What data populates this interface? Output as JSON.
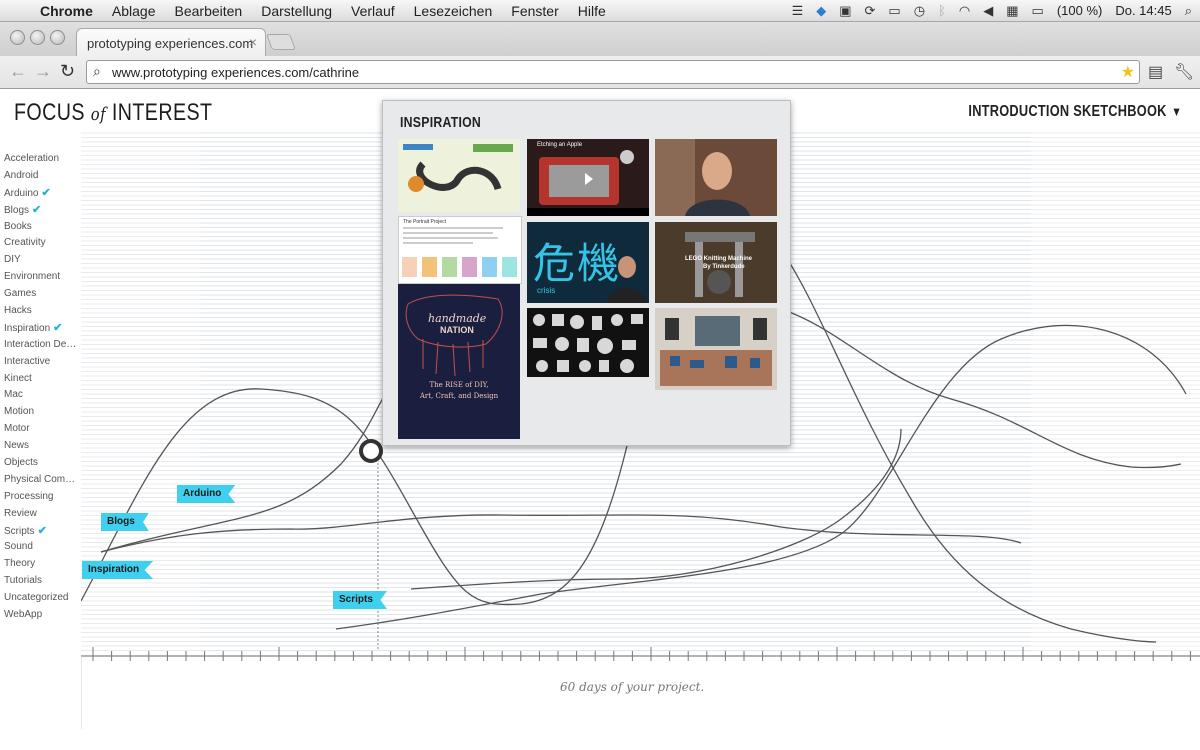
{
  "menubar": {
    "apple": "",
    "items": [
      "Chrome",
      "Ablage",
      "Bearbeiten",
      "Darstellung",
      "Verlauf",
      "Lesezeichen",
      "Fenster",
      "Hilfe"
    ],
    "battery": "(100 %)",
    "clock": "Do. 14:45"
  },
  "browser": {
    "tab_title": "prototyping experiences.com",
    "tab_close": "×",
    "url": "www.prototyping experiences.com/cathrine"
  },
  "page": {
    "logo_left": "FOCUS",
    "logo_of": "of",
    "logo_right": "INTEREST",
    "sketchbook_label": "INTRODUCTION SKETCHBOOK",
    "footer_text": "60 days of your project."
  },
  "sidebar": {
    "items": [
      {
        "label": "Acceleration",
        "checked": false
      },
      {
        "label": "Android",
        "checked": false
      },
      {
        "label": "Arduino",
        "checked": true
      },
      {
        "label": "Blogs",
        "checked": true
      },
      {
        "label": "Books",
        "checked": false
      },
      {
        "label": "Creativity",
        "checked": false
      },
      {
        "label": "DIY",
        "checked": false
      },
      {
        "label": "Environment",
        "checked": false
      },
      {
        "label": "Games",
        "checked": false
      },
      {
        "label": "Hacks",
        "checked": false
      },
      {
        "label": "Inspiration",
        "checked": true
      },
      {
        "label": "Interaction Design",
        "checked": false
      },
      {
        "label": "Interactive",
        "checked": false
      },
      {
        "label": "Kinect",
        "checked": false
      },
      {
        "label": "Mac",
        "checked": false
      },
      {
        "label": "Motion",
        "checked": false
      },
      {
        "label": "Motor",
        "checked": false
      },
      {
        "label": "News",
        "checked": false
      },
      {
        "label": "Objects",
        "checked": false
      },
      {
        "label": "Physical Comput...",
        "checked": false
      },
      {
        "label": "Processing",
        "checked": false
      },
      {
        "label": "Review",
        "checked": false
      },
      {
        "label": "Scripts",
        "checked": true
      },
      {
        "label": "Sound",
        "checked": false
      },
      {
        "label": "Theory",
        "checked": false
      },
      {
        "label": "Tutorials",
        "checked": false
      },
      {
        "label": "Uncategorized",
        "checked": false
      },
      {
        "label": "WebApp",
        "checked": false
      }
    ]
  },
  "flags": {
    "inspiration": "Inspiration",
    "blogs": "Blogs",
    "arduino": "Arduino",
    "scripts": "Scripts"
  },
  "popup": {
    "title": "INSPIRATION",
    "book_title_line1": "handmade",
    "book_title_line2": "NATION",
    "book_subtitle_1": "The RISE of DIY,",
    "book_subtitle_2": "Art, Craft, and Design",
    "video_text": "Etching an Apple",
    "kanji": "危機",
    "kanji_caption": "crisis",
    "lego_text": "LEGO Knitting Machine",
    "lego_sub": "By Tinkerdude",
    "doc_title": "The Portrait Project"
  },
  "colors": {
    "accent": "#3fd0ef",
    "check": "#1fb5d9",
    "book_bg": "#1b1f3f",
    "book_ink": "#c1504b"
  }
}
